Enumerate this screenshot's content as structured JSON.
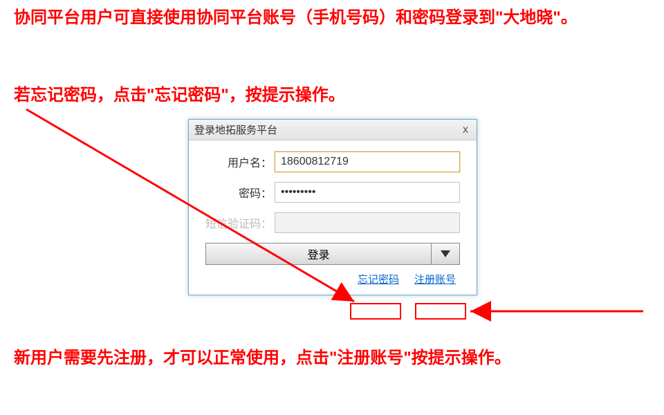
{
  "instructions": {
    "p1": "协同平台用户可直接使用协同平台账号（手机号码）和密码登录到\"大地晓\"。",
    "p2": "若忘记密码，点击\"忘记密码\"，按提示操作。",
    "p3": "新用户需要先注册，才可以正常使用，点击\"注册账号\"按提示操作。"
  },
  "dialog": {
    "title": "登录地拓服务平台",
    "close_label": "x",
    "username_label": "用户名：",
    "username_value": "18600812719",
    "password_label": "密码：",
    "password_value": "•••••••••",
    "smscode_label": "短信验证码：",
    "smscode_value": "",
    "login_button": "登录",
    "forgot_link": "忘记密码",
    "register_link": "注册账号"
  }
}
